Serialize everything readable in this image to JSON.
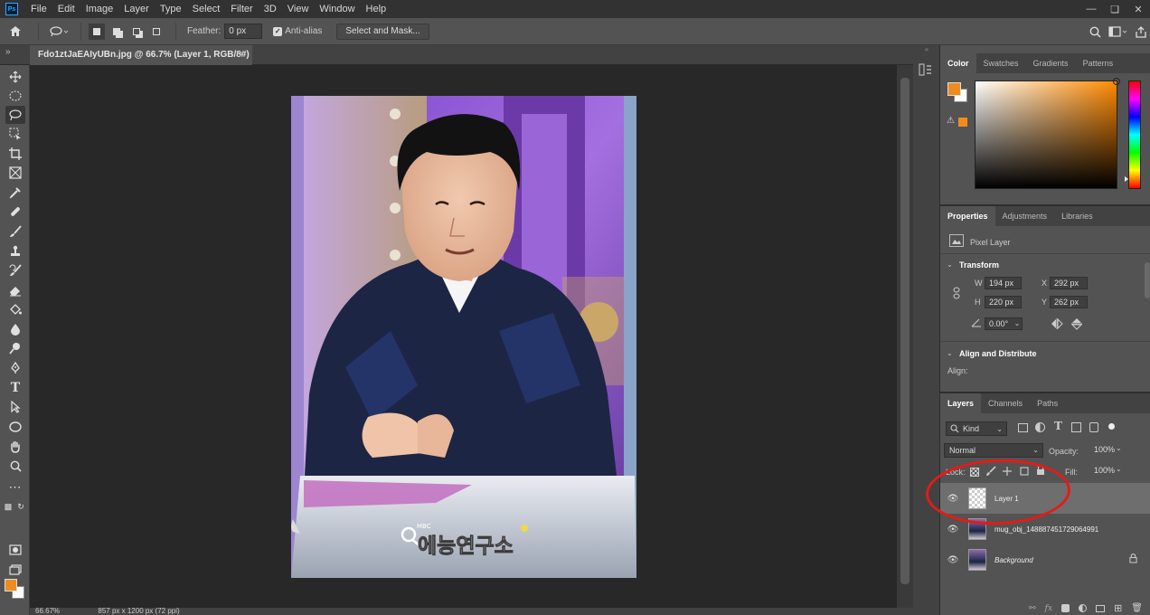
{
  "app": {
    "logo": "Ps"
  },
  "menu": [
    "File",
    "Edit",
    "Image",
    "Layer",
    "Type",
    "Select",
    "Filter",
    "3D",
    "View",
    "Window",
    "Help"
  ],
  "options": {
    "feather_label": "Feather:",
    "feather_value": "0 px",
    "anti_alias_label": "Anti-alias",
    "select_mask_label": "Select and Mask..."
  },
  "document": {
    "tab_title": "Fdo1ztJaEAIyUBn.jpg @ 66.7% (Layer 1, RGB/8#) *",
    "overlay_logo_text": "에능연구소",
    "overlay_small_text": "MBC"
  },
  "status": {
    "zoom": "66.67%",
    "dimensions": "857 px x 1200 px (72 ppi)"
  },
  "color_panel": {
    "tabs": [
      "Color",
      "Swatches",
      "Gradients",
      "Patterns"
    ],
    "foreground_color": "#f08c1e",
    "background_color": "#ffffff"
  },
  "properties_panel": {
    "tabs": [
      "Properties",
      "Adjustments",
      "Libraries"
    ],
    "layer_type": "Pixel Layer",
    "transform_title": "Transform",
    "w_label": "W",
    "w_value": "194 px",
    "x_label": "X",
    "x_value": "292 px",
    "h_label": "H",
    "h_value": "220 px",
    "y_label": "Y",
    "y_value": "262 px",
    "angle_value": "0.00°",
    "align_title": "Align and Distribute",
    "align_label": "Align:"
  },
  "layers_panel": {
    "tabs": [
      "Layers",
      "Channels",
      "Paths"
    ],
    "filter_kind": "Kind",
    "blend_mode": "Normal",
    "opacity_label": "Opacity:",
    "opacity_value": "100%",
    "lock_label": "Lock:",
    "fill_label": "Fill:",
    "fill_value": "100%",
    "layers": [
      {
        "name": "Layer 1",
        "selected": true
      },
      {
        "name": "mug_obj_148887451729064991",
        "selected": false
      },
      {
        "name": "Background",
        "selected": false
      }
    ]
  },
  "annotation": {
    "color": "#e41b17"
  }
}
